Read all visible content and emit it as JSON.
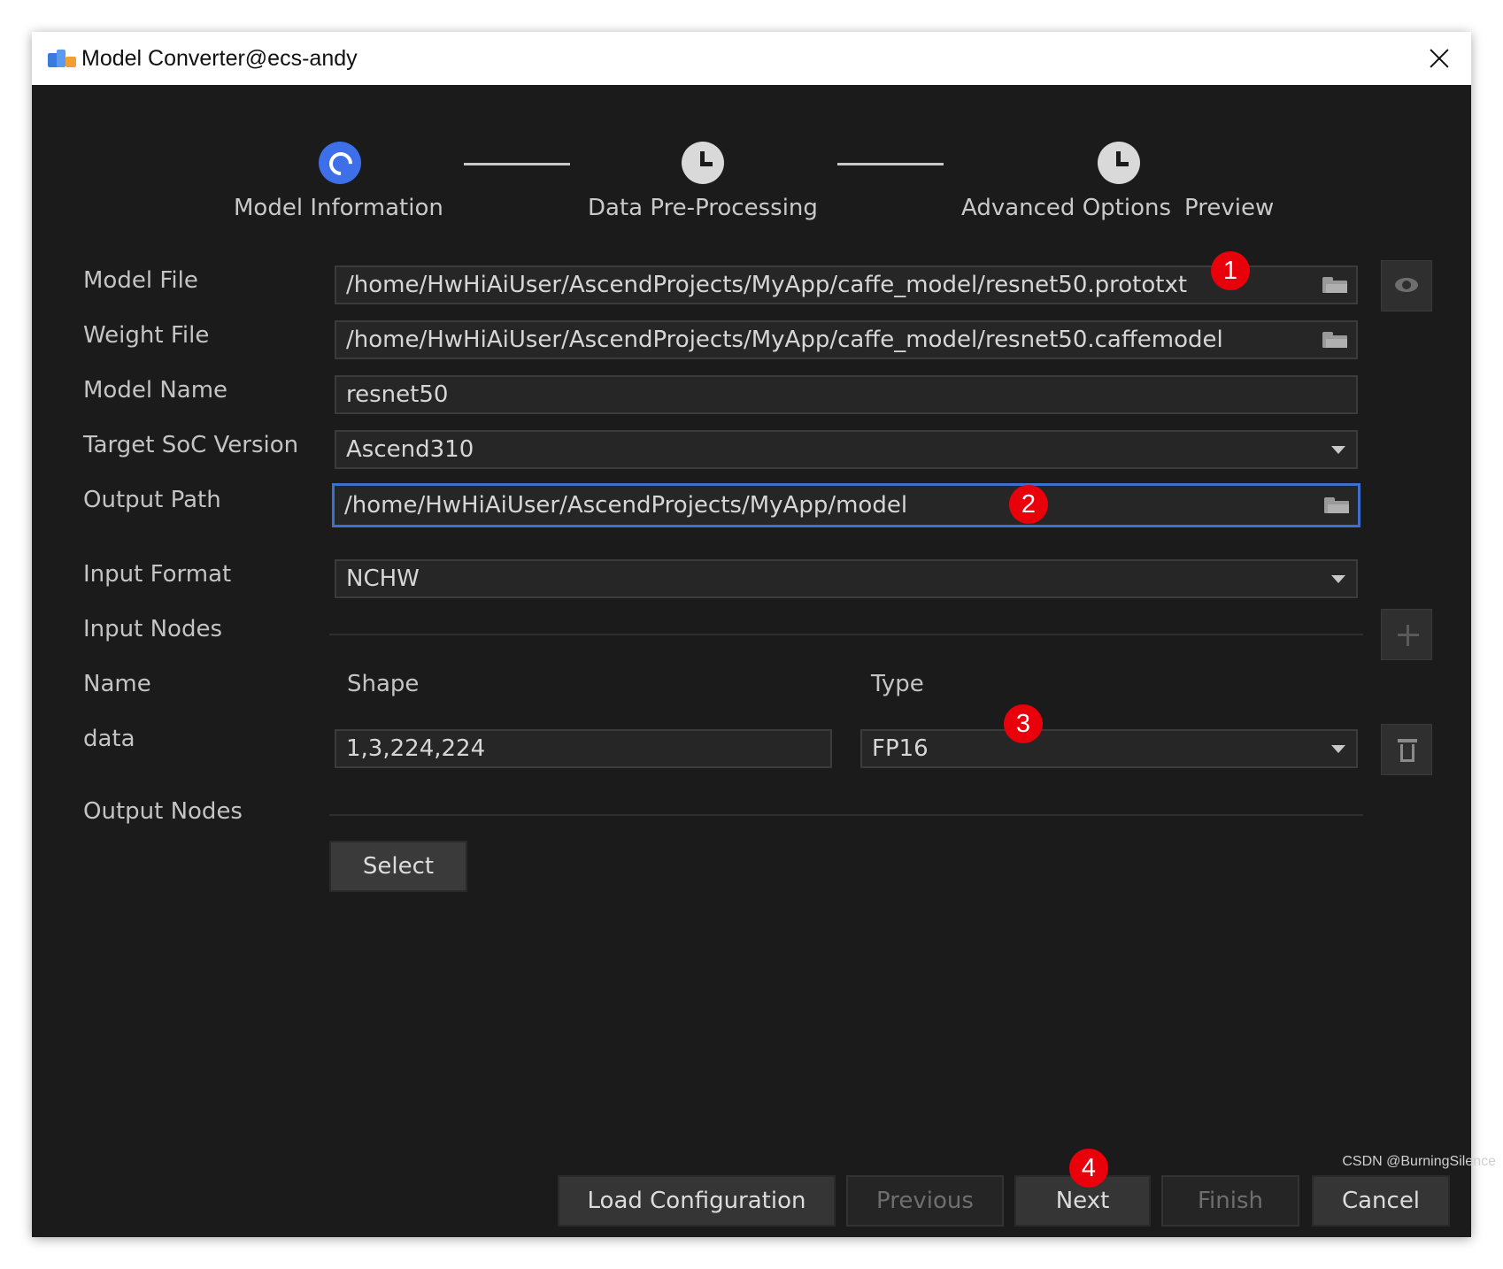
{
  "window": {
    "title": "Model Converter@ecs-andy"
  },
  "stepper": {
    "steps": [
      {
        "label": "Model Information",
        "state": "active"
      },
      {
        "label": "Data Pre-Processing",
        "state": "pending"
      },
      {
        "label": "Advanced Options",
        "state": "pending"
      },
      {
        "label": "Preview",
        "state": "pending"
      }
    ]
  },
  "form": {
    "model_file": {
      "label": "Model File",
      "value": "/home/HwHiAiUser/AscendProjects/MyApp/caffe_model/resnet50.prototxt"
    },
    "weight_file": {
      "label": "Weight File",
      "value": "/home/HwHiAiUser/AscendProjects/MyApp/caffe_model/resnet50.caffemodel"
    },
    "model_name": {
      "label": "Model Name",
      "value": "resnet50"
    },
    "target_soc": {
      "label": "Target SoC Version",
      "value": "Ascend310"
    },
    "output_path": {
      "label": "Output Path",
      "value": "/home/HwHiAiUser/AscendProjects/MyApp/model"
    },
    "input_format": {
      "label": "Input Format",
      "value": "NCHW"
    },
    "input_nodes": {
      "label": "Input Nodes",
      "col_name": "Name",
      "col_shape": "Shape",
      "col_type": "Type",
      "rows": [
        {
          "name": "data",
          "shape": "1,3,224,224",
          "type": "FP16"
        }
      ]
    },
    "output_nodes": {
      "label": "Output Nodes",
      "select_label": "Select"
    }
  },
  "footer": {
    "load_config": "Load Configuration",
    "previous": "Previous",
    "next": "Next",
    "finish": "Finish",
    "cancel": "Cancel"
  },
  "annotations": [
    "1",
    "2",
    "3",
    "4"
  ],
  "colors": {
    "accent": "#3d6fe8",
    "background": "#1b1b1b",
    "badge": "#e8000b"
  },
  "watermark": "CSDN @BurningSilence"
}
